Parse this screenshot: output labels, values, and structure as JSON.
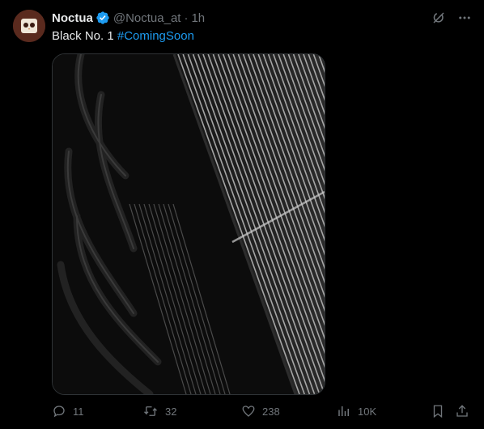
{
  "tweet": {
    "author_name": "Noctua",
    "handle": "@Noctua_at",
    "separator": "·",
    "time": "1h",
    "text_main": "Black No. 1 ",
    "hashtag": "#ComingSoon"
  },
  "stats": {
    "replies": "11",
    "retweets": "32",
    "likes": "238",
    "views": "10K"
  },
  "colors": {
    "accent": "#1d9bf0",
    "muted": "#71767b",
    "avatar_bg": "#5a2a1e"
  },
  "icons": {
    "verified": "verified-badge-icon",
    "grok": "grok-icon",
    "more": "more-icon",
    "reply": "reply-icon",
    "retweet": "retweet-icon",
    "like": "like-icon",
    "views": "views-icon",
    "bookmark": "bookmark-icon",
    "share": "share-icon"
  }
}
